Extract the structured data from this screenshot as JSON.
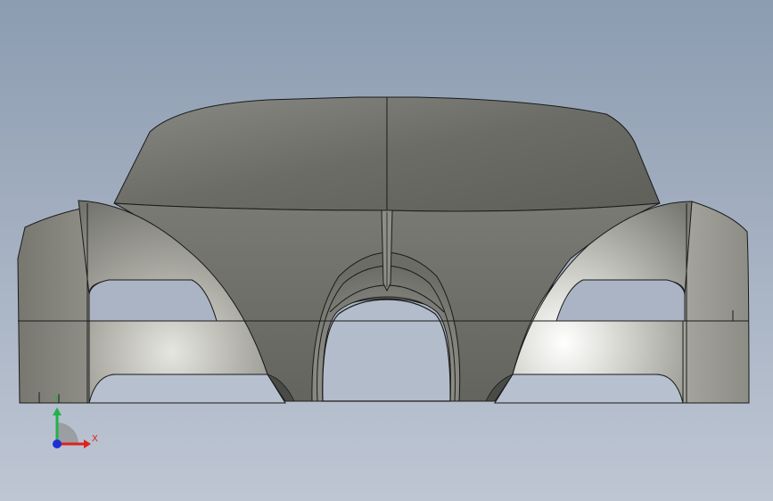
{
  "viewport": {
    "background_top": "#8c9cb1",
    "background_bottom": "#bec6d3"
  },
  "model": {
    "body_color": "#6f6f6a",
    "edge_color": "#1a1a1a",
    "highlight_color": "#f2f2ee"
  },
  "triad": {
    "x_label": "X",
    "y_label": "Y",
    "x_color": "#e0201c",
    "y_color": "#22b14c",
    "z_color": "#1c2fd8"
  }
}
